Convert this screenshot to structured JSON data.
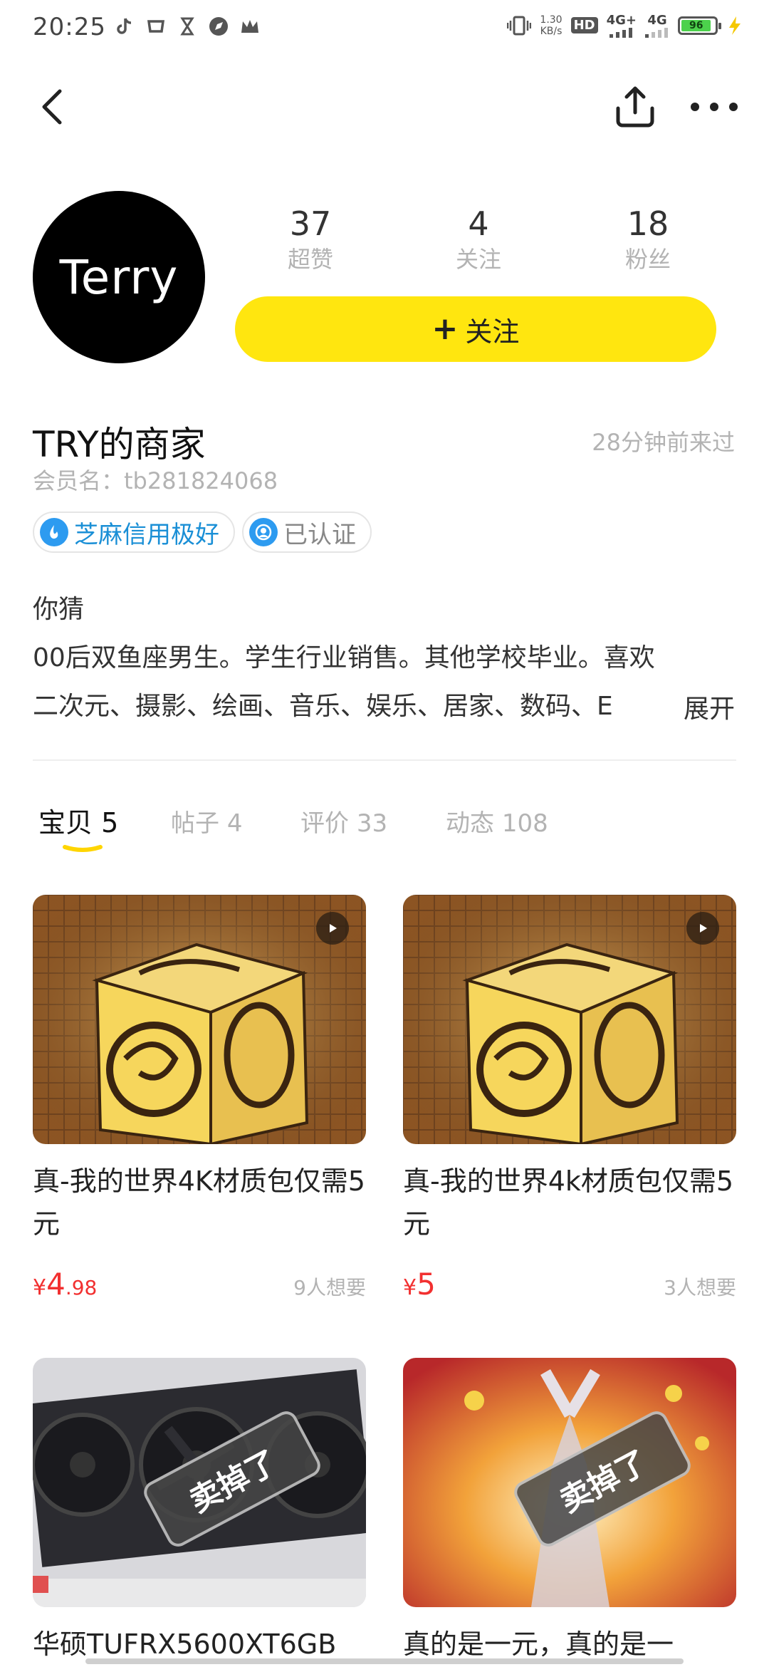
{
  "status_bar": {
    "time": "20:25",
    "net_speed_top": "1.30",
    "net_speed_bottom": "KB/s",
    "hd_label": "HD",
    "sig1_label": "4G+",
    "sig2_label": "4G",
    "battery_level": "96"
  },
  "nav": {
    "back_icon": "chevron-left-icon",
    "share_icon": "share-upload-icon",
    "more_icon": "more-dots-icon"
  },
  "profile": {
    "avatar_text": "Terry",
    "stats": [
      {
        "value": "37",
        "label": "超赞"
      },
      {
        "value": "4",
        "label": "关注"
      },
      {
        "value": "18",
        "label": "粉丝"
      }
    ],
    "follow_label": "关注",
    "follow_plus": "+",
    "shop_name": "TRY的商家",
    "last_seen": "28分钟前来过",
    "member_id": "会员名：tb281824068",
    "badges": [
      {
        "label": "芝麻信用极好",
        "icon": "sesame-credit-icon"
      },
      {
        "label": "已认证",
        "icon": "verified-person-icon"
      }
    ],
    "bio_title": "你猜",
    "bio_line1": "00后双鱼座男生。学生行业销售。其他学校毕业。喜欢",
    "bio_line2": "二次元、摄影、绘画、音乐、娱乐、居家、数码、E",
    "expand_label": "展开"
  },
  "tabs": [
    {
      "label": "宝贝",
      "count": "5",
      "active": true
    },
    {
      "label": "帖子",
      "count": "4",
      "active": false
    },
    {
      "label": "评价",
      "count": "33",
      "active": false
    },
    {
      "label": "动态",
      "count": "108",
      "active": false
    }
  ],
  "products": [
    {
      "title": "真-我的世界4K材质包仅需5元",
      "price_symbol": "¥",
      "price_int": "4",
      "price_dec": ".98",
      "want": "9人想要",
      "has_video": true
    },
    {
      "title": "真-我的世界4k材质包仅需5元",
      "price_symbol": "¥",
      "price_int": "5",
      "price_dec": "",
      "want": "3人想要",
      "has_video": true
    },
    {
      "title": "华硕TUFRX5600XT6GB",
      "sold_label": "卖掉了"
    },
    {
      "title": "真的是一元，真的是一",
      "sold_label": "卖掉了"
    }
  ],
  "colors": {
    "accent_yellow": "#ffe60f",
    "price_red": "#f23030",
    "muted_gray": "#b3b3b3",
    "credit_blue": "#1a8fd6"
  }
}
